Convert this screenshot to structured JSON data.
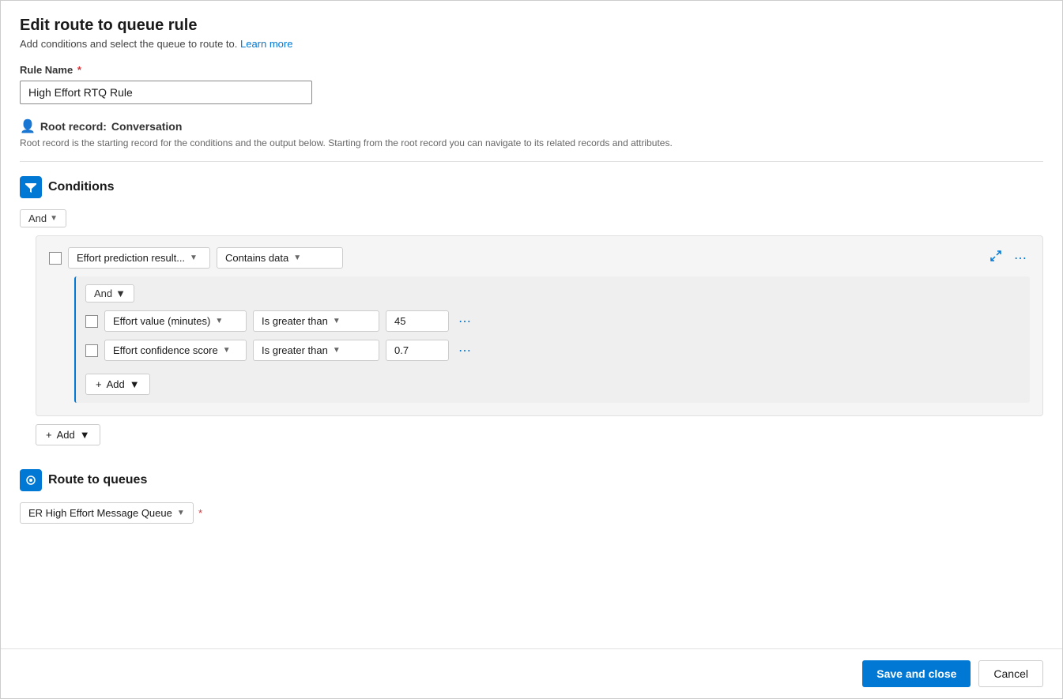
{
  "page": {
    "title": "Edit route to queue rule",
    "subtitle": "Add conditions and select the queue to route to.",
    "learn_more": "Learn more",
    "rule_name_label": "Rule Name",
    "rule_name_value": "High Effort RTQ Rule",
    "root_record_label": "Root record:",
    "root_record_value": "Conversation",
    "root_record_desc": "Root record is the starting record for the conditions and the output below. Starting from the root record you can navigate to its related records and attributes.",
    "conditions_title": "Conditions",
    "and_label": "And",
    "add_label": "+ Add",
    "route_title": "Route to queues"
  },
  "conditions": {
    "outer_checkbox": false,
    "outer_field": "Effort prediction result...",
    "outer_operator": "Contains data",
    "inner": {
      "and_label": "And",
      "rows": [
        {
          "checkbox": false,
          "field": "Effort value (minutes)",
          "operator": "Is greater than",
          "value": "45"
        },
        {
          "checkbox": false,
          "field": "Effort confidence score",
          "operator": "Is greater than",
          "value": "0.7"
        }
      ]
    }
  },
  "route": {
    "queue_label": "ER High Effort Message Queue"
  },
  "footer": {
    "save_label": "Save and close",
    "cancel_label": "Cancel"
  }
}
